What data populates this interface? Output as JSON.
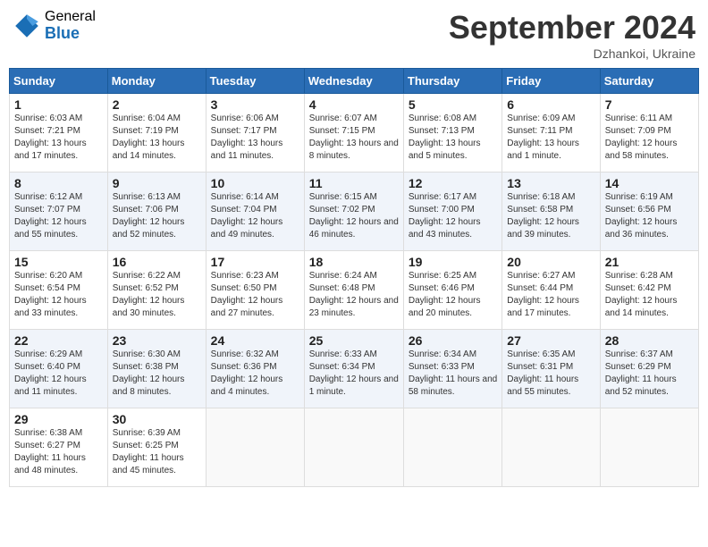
{
  "header": {
    "logo_general": "General",
    "logo_blue": "Blue",
    "month_title": "September 2024",
    "subtitle": "Dzhankoi, Ukraine"
  },
  "days_of_week": [
    "Sunday",
    "Monday",
    "Tuesday",
    "Wednesday",
    "Thursday",
    "Friday",
    "Saturday"
  ],
  "weeks": [
    [
      {
        "day": "1",
        "sunrise": "Sunrise: 6:03 AM",
        "sunset": "Sunset: 7:21 PM",
        "daylight": "Daylight: 13 hours and 17 minutes."
      },
      {
        "day": "2",
        "sunrise": "Sunrise: 6:04 AM",
        "sunset": "Sunset: 7:19 PM",
        "daylight": "Daylight: 13 hours and 14 minutes."
      },
      {
        "day": "3",
        "sunrise": "Sunrise: 6:06 AM",
        "sunset": "Sunset: 7:17 PM",
        "daylight": "Daylight: 13 hours and 11 minutes."
      },
      {
        "day": "4",
        "sunrise": "Sunrise: 6:07 AM",
        "sunset": "Sunset: 7:15 PM",
        "daylight": "Daylight: 13 hours and 8 minutes."
      },
      {
        "day": "5",
        "sunrise": "Sunrise: 6:08 AM",
        "sunset": "Sunset: 7:13 PM",
        "daylight": "Daylight: 13 hours and 5 minutes."
      },
      {
        "day": "6",
        "sunrise": "Sunrise: 6:09 AM",
        "sunset": "Sunset: 7:11 PM",
        "daylight": "Daylight: 13 hours and 1 minute."
      },
      {
        "day": "7",
        "sunrise": "Sunrise: 6:11 AM",
        "sunset": "Sunset: 7:09 PM",
        "daylight": "Daylight: 12 hours and 58 minutes."
      }
    ],
    [
      {
        "day": "8",
        "sunrise": "Sunrise: 6:12 AM",
        "sunset": "Sunset: 7:07 PM",
        "daylight": "Daylight: 12 hours and 55 minutes."
      },
      {
        "day": "9",
        "sunrise": "Sunrise: 6:13 AM",
        "sunset": "Sunset: 7:06 PM",
        "daylight": "Daylight: 12 hours and 52 minutes."
      },
      {
        "day": "10",
        "sunrise": "Sunrise: 6:14 AM",
        "sunset": "Sunset: 7:04 PM",
        "daylight": "Daylight: 12 hours and 49 minutes."
      },
      {
        "day": "11",
        "sunrise": "Sunrise: 6:15 AM",
        "sunset": "Sunset: 7:02 PM",
        "daylight": "Daylight: 12 hours and 46 minutes."
      },
      {
        "day": "12",
        "sunrise": "Sunrise: 6:17 AM",
        "sunset": "Sunset: 7:00 PM",
        "daylight": "Daylight: 12 hours and 43 minutes."
      },
      {
        "day": "13",
        "sunrise": "Sunrise: 6:18 AM",
        "sunset": "Sunset: 6:58 PM",
        "daylight": "Daylight: 12 hours and 39 minutes."
      },
      {
        "day": "14",
        "sunrise": "Sunrise: 6:19 AM",
        "sunset": "Sunset: 6:56 PM",
        "daylight": "Daylight: 12 hours and 36 minutes."
      }
    ],
    [
      {
        "day": "15",
        "sunrise": "Sunrise: 6:20 AM",
        "sunset": "Sunset: 6:54 PM",
        "daylight": "Daylight: 12 hours and 33 minutes."
      },
      {
        "day": "16",
        "sunrise": "Sunrise: 6:22 AM",
        "sunset": "Sunset: 6:52 PM",
        "daylight": "Daylight: 12 hours and 30 minutes."
      },
      {
        "day": "17",
        "sunrise": "Sunrise: 6:23 AM",
        "sunset": "Sunset: 6:50 PM",
        "daylight": "Daylight: 12 hours and 27 minutes."
      },
      {
        "day": "18",
        "sunrise": "Sunrise: 6:24 AM",
        "sunset": "Sunset: 6:48 PM",
        "daylight": "Daylight: 12 hours and 23 minutes."
      },
      {
        "day": "19",
        "sunrise": "Sunrise: 6:25 AM",
        "sunset": "Sunset: 6:46 PM",
        "daylight": "Daylight: 12 hours and 20 minutes."
      },
      {
        "day": "20",
        "sunrise": "Sunrise: 6:27 AM",
        "sunset": "Sunset: 6:44 PM",
        "daylight": "Daylight: 12 hours and 17 minutes."
      },
      {
        "day": "21",
        "sunrise": "Sunrise: 6:28 AM",
        "sunset": "Sunset: 6:42 PM",
        "daylight": "Daylight: 12 hours and 14 minutes."
      }
    ],
    [
      {
        "day": "22",
        "sunrise": "Sunrise: 6:29 AM",
        "sunset": "Sunset: 6:40 PM",
        "daylight": "Daylight: 12 hours and 11 minutes."
      },
      {
        "day": "23",
        "sunrise": "Sunrise: 6:30 AM",
        "sunset": "Sunset: 6:38 PM",
        "daylight": "Daylight: 12 hours and 8 minutes."
      },
      {
        "day": "24",
        "sunrise": "Sunrise: 6:32 AM",
        "sunset": "Sunset: 6:36 PM",
        "daylight": "Daylight: 12 hours and 4 minutes."
      },
      {
        "day": "25",
        "sunrise": "Sunrise: 6:33 AM",
        "sunset": "Sunset: 6:34 PM",
        "daylight": "Daylight: 12 hours and 1 minute."
      },
      {
        "day": "26",
        "sunrise": "Sunrise: 6:34 AM",
        "sunset": "Sunset: 6:33 PM",
        "daylight": "Daylight: 11 hours and 58 minutes."
      },
      {
        "day": "27",
        "sunrise": "Sunrise: 6:35 AM",
        "sunset": "Sunset: 6:31 PM",
        "daylight": "Daylight: 11 hours and 55 minutes."
      },
      {
        "day": "28",
        "sunrise": "Sunrise: 6:37 AM",
        "sunset": "Sunset: 6:29 PM",
        "daylight": "Daylight: 11 hours and 52 minutes."
      }
    ],
    [
      {
        "day": "29",
        "sunrise": "Sunrise: 6:38 AM",
        "sunset": "Sunset: 6:27 PM",
        "daylight": "Daylight: 11 hours and 48 minutes."
      },
      {
        "day": "30",
        "sunrise": "Sunrise: 6:39 AM",
        "sunset": "Sunset: 6:25 PM",
        "daylight": "Daylight: 11 hours and 45 minutes."
      },
      null,
      null,
      null,
      null,
      null
    ]
  ]
}
